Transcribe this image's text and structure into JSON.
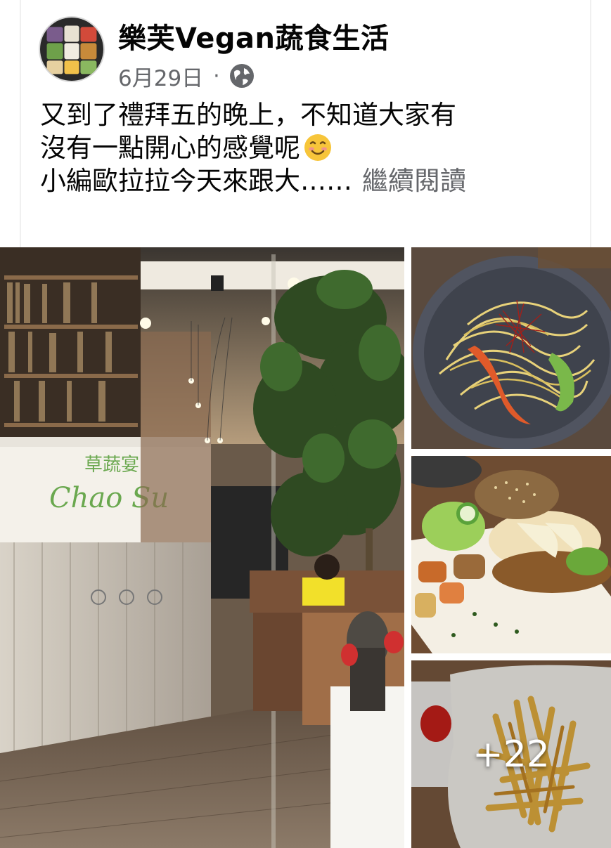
{
  "post": {
    "page_name": "樂芙Vegan蔬食生活",
    "date": "6月29日",
    "separator": "·",
    "privacy_icon": "globe-icon",
    "text_lines": [
      "又到了禮拜五的晚上，不知道大家有",
      "沒有一點開心的感覺呢",
      "小編歐拉拉今天來跟大……"
    ],
    "emoji": "smiling-face-emoji",
    "see_more": "繼續閱讀"
  },
  "gallery": {
    "photos": [
      {
        "name": "restaurant-interior-photo",
        "sign_text": "草蔬宴",
        "sign_script": "Chao Su"
      },
      {
        "name": "pasta-dish-photo"
      },
      {
        "name": "veggie-burger-photo"
      },
      {
        "name": "fries-photo"
      }
    ],
    "more_count": "+22"
  },
  "colors": {
    "text_primary": "#050505",
    "text_secondary": "#65676b",
    "background": "#ffffff"
  }
}
